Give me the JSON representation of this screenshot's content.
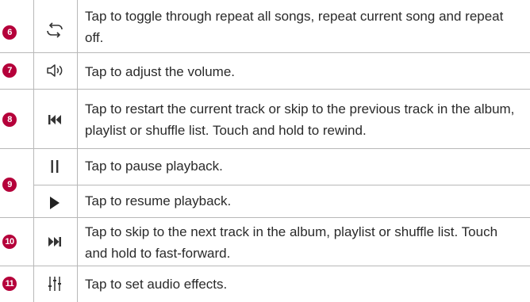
{
  "rows": [
    {
      "number": "6",
      "icon": "repeat-icon",
      "text": "Tap to toggle through repeat all songs, repeat current song and repeat off."
    },
    {
      "number": "7",
      "icon": "volume-icon",
      "text": "Tap to adjust the volume."
    },
    {
      "number": "8",
      "icon": "previous-track-icon",
      "text": "Tap to restart the current track or skip to the previous track in the album, playlist or shuffle list. Touch and hold to rewind."
    },
    {
      "number": "9",
      "icon": "pause-icon",
      "text": "Tap to pause playback."
    },
    {
      "number": "",
      "icon": "play-icon",
      "text": "Tap to resume playback."
    },
    {
      "number": "10",
      "icon": "next-track-icon",
      "text": "Tap to skip to the next track in the album, playlist or shuffle list. Touch and hold to fast-forward."
    },
    {
      "number": "11",
      "icon": "audio-effects-icon",
      "text": "Tap to set audio effects."
    }
  ],
  "colors": {
    "number_badge": "#b5003a",
    "rule": "#b8b8b8",
    "icon": "#333333"
  }
}
